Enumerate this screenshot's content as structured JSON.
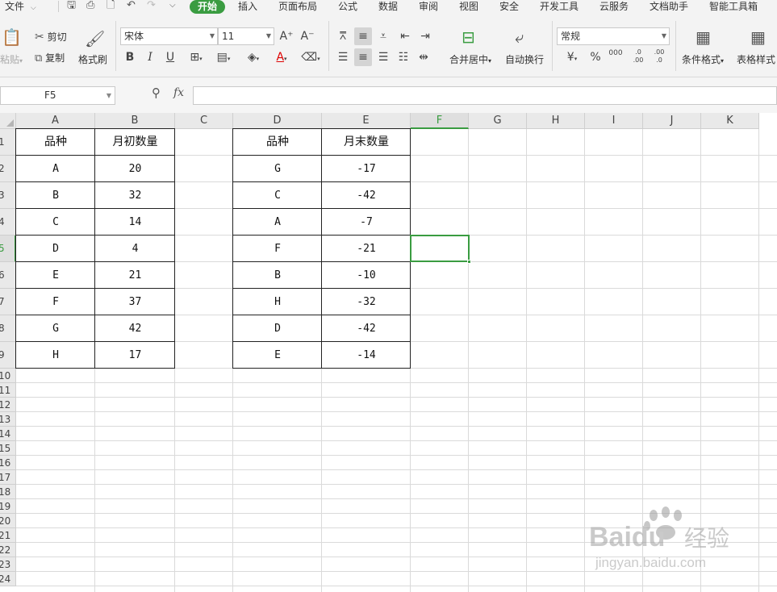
{
  "menubar": {
    "file": "文件",
    "tabs": [
      "开始",
      "插入",
      "页面布局",
      "公式",
      "数据",
      "审阅",
      "视图",
      "安全",
      "开发工具",
      "云服务",
      "文档助手",
      "智能工具箱"
    ]
  },
  "ribbon": {
    "paste": "粘贴",
    "cut": "剪切",
    "copy": "复制",
    "format_painter": "格式刷",
    "font_name": "宋体",
    "font_size": "11",
    "merge_center": "合并居中",
    "wrap_text": "自动换行",
    "number_format": "常规",
    "percent": "%",
    "thousands": "000",
    "inc_decimal": ".0\n.00",
    "dec_decimal": ".00\n.0",
    "conditional_format": "条件格式",
    "table_style": "表格样式",
    "bold": "B",
    "italic": "I",
    "underline": "U",
    "grow_font": "A⁺",
    "shrink_font": "A⁻",
    "font_color": "A"
  },
  "formula_bar": {
    "name_box": "F5",
    "fx": "fx",
    "formula": ""
  },
  "grid": {
    "columns": [
      "A",
      "B",
      "C",
      "D",
      "E",
      "F",
      "G",
      "H",
      "I",
      "J",
      "K"
    ],
    "rows": [
      "1",
      "2",
      "3",
      "4",
      "5",
      "6",
      "7",
      "8",
      "9",
      "10",
      "11",
      "12",
      "13",
      "14",
      "15",
      "16",
      "17",
      "18",
      "19",
      "20",
      "21",
      "22",
      "23",
      "24"
    ],
    "selected_column": "F",
    "selected_row": "5"
  },
  "table1": {
    "headers": [
      "品种",
      "月初数量"
    ],
    "rows": [
      [
        "A",
        "20"
      ],
      [
        "B",
        "32"
      ],
      [
        "C",
        "14"
      ],
      [
        "D",
        "4"
      ],
      [
        "E",
        "21"
      ],
      [
        "F",
        "37"
      ],
      [
        "G",
        "42"
      ],
      [
        "H",
        "17"
      ]
    ]
  },
  "table2": {
    "headers": [
      "品种",
      "月末数量"
    ],
    "rows": [
      [
        "G",
        "-17"
      ],
      [
        "C",
        "-42"
      ],
      [
        "A",
        "-7"
      ],
      [
        "F",
        "-21"
      ],
      [
        "B",
        "-10"
      ],
      [
        "H",
        "-32"
      ],
      [
        "D",
        "-42"
      ],
      [
        "E",
        "-14"
      ]
    ]
  },
  "watermark": {
    "brand": "Baidu",
    "cn": "经验",
    "url": "jingyan.baidu.com"
  }
}
